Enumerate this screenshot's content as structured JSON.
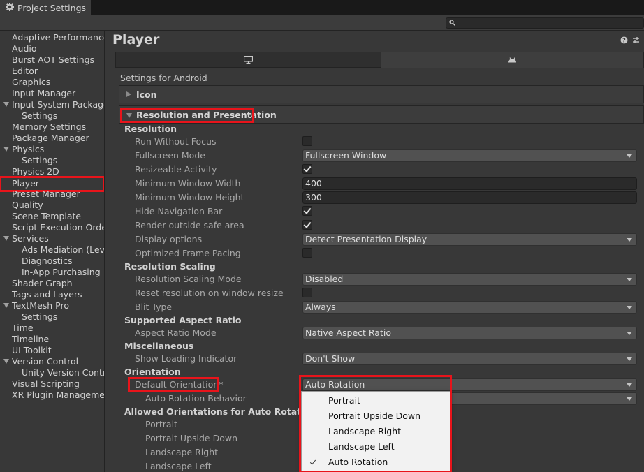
{
  "window": {
    "title": "Project Settings"
  },
  "search": {
    "placeholder": ""
  },
  "sidebar": {
    "items": [
      {
        "label": "Adaptive Performance"
      },
      {
        "label": "Audio"
      },
      {
        "label": "Burst AOT Settings"
      },
      {
        "label": "Editor"
      },
      {
        "label": "Graphics"
      },
      {
        "label": "Input Manager"
      },
      {
        "label": "Input System Package"
      },
      {
        "label": "Settings"
      },
      {
        "label": "Memory Settings"
      },
      {
        "label": "Package Manager"
      },
      {
        "label": "Physics"
      },
      {
        "label": "Settings"
      },
      {
        "label": "Physics 2D"
      },
      {
        "label": "Player"
      },
      {
        "label": "Preset Manager"
      },
      {
        "label": "Quality"
      },
      {
        "label": "Scene Template"
      },
      {
        "label": "Script Execution Order"
      },
      {
        "label": "Services"
      },
      {
        "label": "Ads Mediation (Level"
      },
      {
        "label": "Diagnostics"
      },
      {
        "label": "In-App Purchasing"
      },
      {
        "label": "Shader Graph"
      },
      {
        "label": "Tags and Layers"
      },
      {
        "label": "TextMesh Pro"
      },
      {
        "label": "Settings"
      },
      {
        "label": "Time"
      },
      {
        "label": "Timeline"
      },
      {
        "label": "UI Toolkit"
      },
      {
        "label": "Version Control"
      },
      {
        "label": "Unity Version Control"
      },
      {
        "label": "Visual Scripting"
      },
      {
        "label": "XR Plugin Management"
      }
    ]
  },
  "main": {
    "title": "Player",
    "settings_for": "Settings for Android",
    "icon_foldout": "Icon",
    "res_foldout": "Resolution and Presentation",
    "sections": {
      "resolution": "Resolution",
      "scaling": "Resolution Scaling",
      "aspect": "Supported Aspect Ratio",
      "misc": "Miscellaneous",
      "orientation": "Orientation",
      "allowed": "Allowed Orientations for Auto Rotation"
    },
    "props": {
      "run_without_focus": "Run Without Focus",
      "fullscreen_mode": "Fullscreen Mode",
      "fullscreen_mode_value": "Fullscreen Window",
      "resizeable": "Resizeable Activity",
      "min_width": "Minimum Window Width",
      "min_width_value": "400",
      "min_height": "Minimum Window Height",
      "min_height_value": "300",
      "hide_nav": "Hide Navigation Bar",
      "render_safe": "Render outside safe area",
      "display_options": "Display options",
      "display_options_value": "Detect Presentation Display",
      "frame_pacing": "Optimized Frame Pacing",
      "scaling_mode": "Resolution Scaling Mode",
      "scaling_mode_value": "Disabled",
      "reset_resolution": "Reset resolution on window resize",
      "blit_type": "Blit Type",
      "blit_type_value": "Always",
      "aspect_mode": "Aspect Ratio Mode",
      "aspect_mode_value": "Native Aspect Ratio",
      "loading_indicator": "Show Loading Indicator",
      "loading_indicator_value": "Don't Show",
      "default_orientation": "Default Orientation*",
      "default_orientation_value": "Auto Rotation",
      "auto_rotation_behavior": "Auto Rotation Behavior",
      "portrait": "Portrait",
      "portrait_ud": "Portrait Upside Down",
      "landscape_right": "Landscape Right",
      "landscape_left": "Landscape Left"
    },
    "checks": {
      "run_without_focus": false,
      "resizeable": true,
      "hide_nav": true,
      "render_safe": true,
      "frame_pacing": false,
      "reset_resolution": false
    }
  },
  "popup": {
    "options": [
      "Portrait",
      "Portrait Upside Down",
      "Landscape Right",
      "Landscape Left",
      "Auto Rotation"
    ],
    "selected": "Auto Rotation"
  },
  "colors": {
    "highlight": "#e8141b",
    "bg": "#383838",
    "field": "#515151"
  }
}
